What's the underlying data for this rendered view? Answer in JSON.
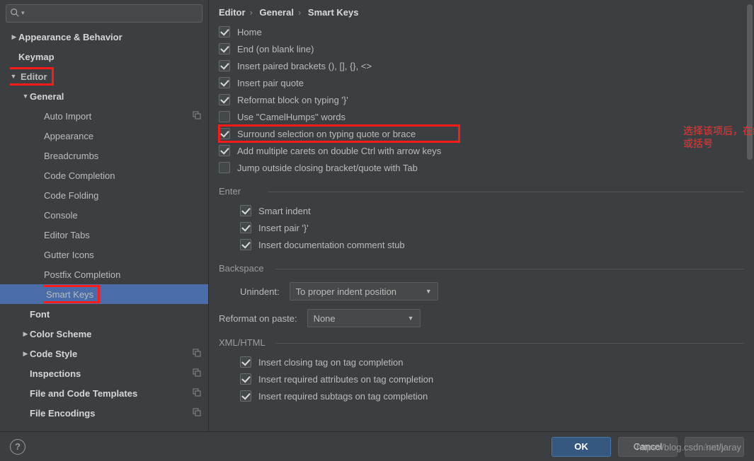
{
  "search": {
    "placeholder": ""
  },
  "sidebar": {
    "items": [
      {
        "label": "Appearance & Behavior",
        "level": 0,
        "bold": true,
        "arrow": "right"
      },
      {
        "label": "Keymap",
        "level": 0,
        "bold": true
      },
      {
        "label": "Editor",
        "level": 0,
        "bold": true,
        "arrow": "down",
        "highlight": true
      },
      {
        "label": "General",
        "level": 1,
        "bold": true,
        "arrow": "down"
      },
      {
        "label": "Auto Import",
        "level": 2,
        "copy": true
      },
      {
        "label": "Appearance",
        "level": 2
      },
      {
        "label": "Breadcrumbs",
        "level": 2
      },
      {
        "label": "Code Completion",
        "level": 2
      },
      {
        "label": "Code Folding",
        "level": 2
      },
      {
        "label": "Console",
        "level": 2
      },
      {
        "label": "Editor Tabs",
        "level": 2
      },
      {
        "label": "Gutter Icons",
        "level": 2
      },
      {
        "label": "Postfix Completion",
        "level": 2
      },
      {
        "label": "Smart Keys",
        "level": 2,
        "selected": true,
        "highlight": true
      },
      {
        "label": "Font",
        "level": 1,
        "bold": true
      },
      {
        "label": "Color Scheme",
        "level": 1,
        "bold": true,
        "arrow": "right"
      },
      {
        "label": "Code Style",
        "level": 1,
        "bold": true,
        "arrow": "right",
        "copy": true
      },
      {
        "label": "Inspections",
        "level": 1,
        "bold": true,
        "copy": true
      },
      {
        "label": "File and Code Templates",
        "level": 1,
        "bold": true,
        "copy": true
      },
      {
        "label": "File Encodings",
        "level": 1,
        "bold": true,
        "copy": true
      }
    ]
  },
  "breadcrumb": {
    "a": "Editor",
    "b": "General",
    "c": "Smart Keys"
  },
  "options": {
    "top": [
      {
        "label": "Home",
        "checked": true
      },
      {
        "label": "End (on blank line)",
        "checked": true
      },
      {
        "label": "Insert paired brackets (), [], {}, <>",
        "checked": true
      },
      {
        "label": "Insert pair quote",
        "checked": true
      },
      {
        "label": "Reformat block on typing '}'",
        "checked": true
      },
      {
        "label": "Use \"CamelHumps\" words",
        "checked": false
      },
      {
        "label": "Surround selection on typing quote or brace",
        "checked": true,
        "highlight": true
      },
      {
        "label": "Add multiple carets on double Ctrl with arrow keys",
        "checked": true
      },
      {
        "label": "Jump outside closing bracket/quote with Tab",
        "checked": false
      }
    ],
    "enter_hdr": "Enter",
    "enter": [
      {
        "label": "Smart indent",
        "checked": true
      },
      {
        "label": "Insert pair '}'",
        "checked": true
      },
      {
        "label": "Insert documentation comment stub",
        "checked": true
      }
    ],
    "backspace_hdr": "Backspace",
    "unindent_label": "Unindent:",
    "unindent_value": "To proper indent position",
    "reformat_label": "Reformat on paste:",
    "reformat_value": "None",
    "xml_hdr": "XML/HTML",
    "xml": [
      {
        "label": "Insert closing tag on tag completion",
        "checked": true
      },
      {
        "label": "Insert required attributes on tag completion",
        "checked": true
      },
      {
        "label": "Insert required subtags on tag completion",
        "checked": true
      }
    ]
  },
  "annotation": "选择该项后，在编辑时，先选择字符，然后单击单(双)引号，或括号",
  "footer": {
    "ok": "OK",
    "cancel": "Cancel",
    "apply": "Apply"
  },
  "watermark": "https://blog.csdn.net/jaray"
}
